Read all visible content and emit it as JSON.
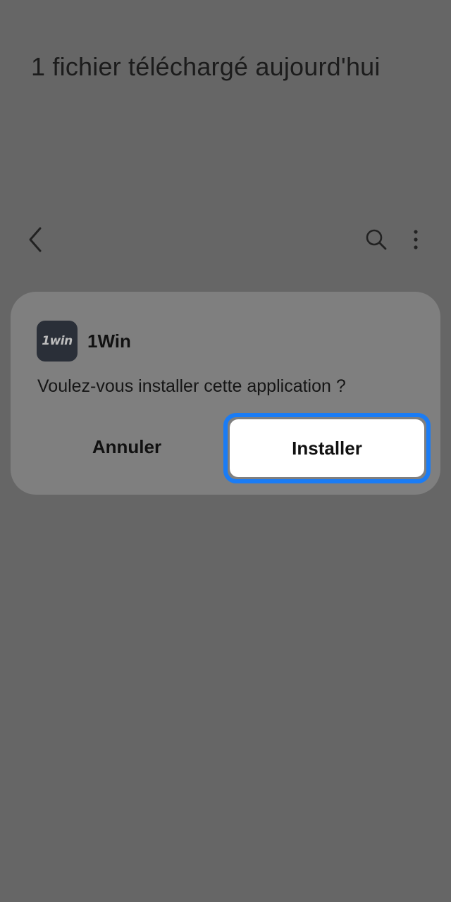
{
  "header": {
    "title": "1 fichier téléchargé aujourd'hui"
  },
  "toolbar": {
    "back_icon": "chevron-left-icon",
    "search_icon": "search-icon",
    "more_icon": "more-vertical-icon"
  },
  "dialog": {
    "app_icon_text": "1win",
    "app_name": "1Win",
    "message": "Voulez-vous installer cette application ?",
    "cancel_label": "Annuler",
    "install_label": "Installer",
    "install_focus_color": "#1a7cf5"
  }
}
